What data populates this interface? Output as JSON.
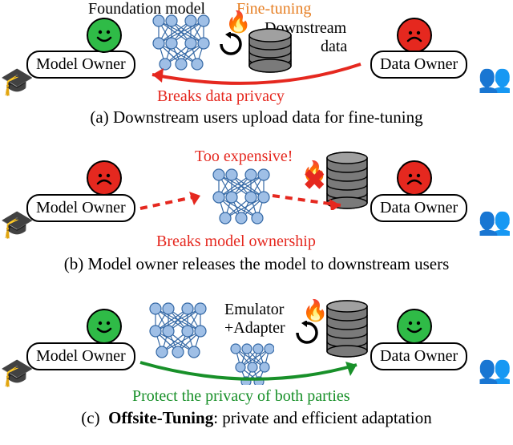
{
  "panelA": {
    "topLabel1": "Foundation model",
    "topLabel2": "Fine-tuning",
    "sideLabel1": "Downstream",
    "sideLabel2": "data",
    "modelOwner": "Model Owner",
    "dataOwner": "Data Owner",
    "breaks": "Breaks data privacy",
    "caption": "(a)  Downstream users upload data for fine-tuning"
  },
  "panelB": {
    "tooExpensive": "Too expensive!",
    "modelOwner": "Model Owner",
    "dataOwner": "Data Owner",
    "breaks": "Breaks model ownership",
    "caption": "(b)  Model owner releases the model to downstream users"
  },
  "panelC": {
    "emuLabel1": "Emulator",
    "emuLabel2": "+Adapter",
    "modelOwner": "Model Owner",
    "dataOwner": "Data Owner",
    "protect": "Protect the privacy of both parties",
    "captionBold": "Offsite-Tuning",
    "captionRest": ": private and efficient adaptation"
  }
}
